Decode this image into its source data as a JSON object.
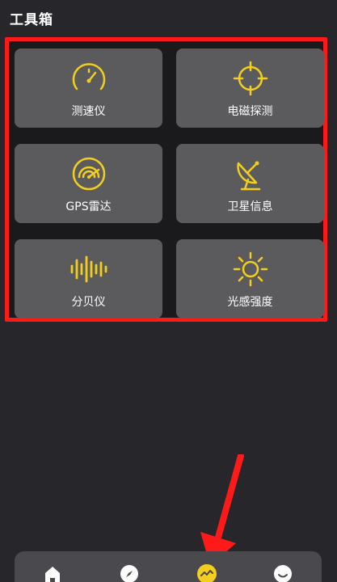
{
  "header": {
    "title": "工具箱"
  },
  "tools": [
    {
      "label": "测速仪",
      "icon": "speedometer-icon"
    },
    {
      "label": "电磁探测",
      "icon": "crosshair-target-icon"
    },
    {
      "label": "GPS雷达",
      "icon": "radar-gauge-icon"
    },
    {
      "label": "卫星信息",
      "icon": "satellite-dish-icon"
    },
    {
      "label": "分贝仪",
      "icon": "sound-wave-icon"
    },
    {
      "label": "光感强度",
      "icon": "sun-brightness-icon"
    }
  ],
  "bottom_nav": {
    "items": [
      {
        "icon": "home-icon"
      },
      {
        "icon": "compass-icon"
      },
      {
        "icon": "toolbox-activity-icon",
        "active": true
      },
      {
        "icon": "smiley-profile-icon"
      }
    ]
  },
  "colors": {
    "accent": "#f2cf1f",
    "highlight_frame": "#ff1a1a",
    "tile_bg": "#5b5b5e",
    "background": "#26262b"
  }
}
